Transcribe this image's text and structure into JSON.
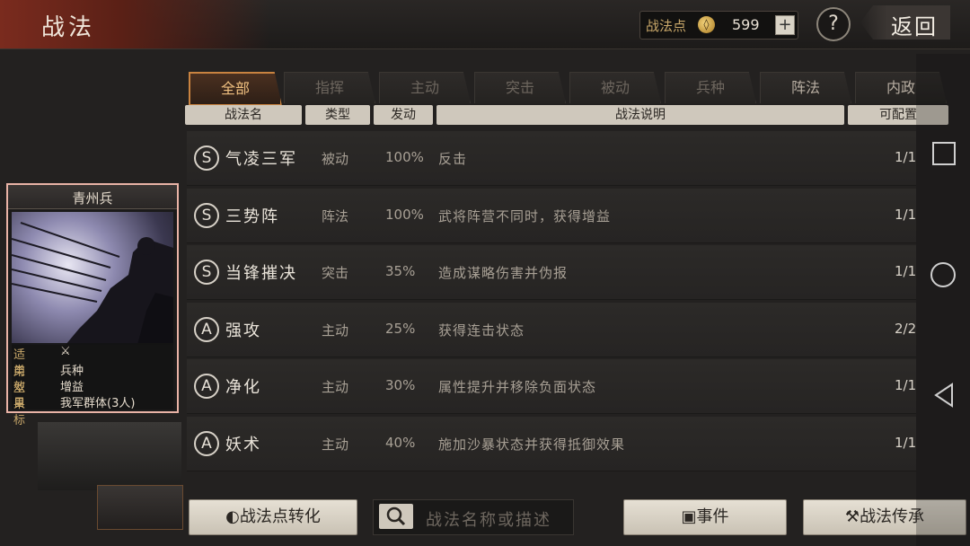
{
  "header": {
    "title": "战法",
    "points_label": "战法点",
    "points_value": "599",
    "help_label": "?",
    "back_label": "返回"
  },
  "tabs": [
    {
      "label": "全部",
      "active": true
    },
    {
      "label": "指挥",
      "active": false
    },
    {
      "label": "主动",
      "active": false
    },
    {
      "label": "突击",
      "active": false
    },
    {
      "label": "被动",
      "active": false
    },
    {
      "label": "兵种",
      "active": false
    },
    {
      "label": "阵法",
      "active": false
    },
    {
      "label": "内政",
      "active": false
    }
  ],
  "columns": {
    "name": "战法名",
    "type": "类型",
    "rate": "发动",
    "desc": "战法说明",
    "count": "可配置"
  },
  "rows": [
    {
      "grade": "S",
      "name": "气凌三军",
      "type": "被动",
      "rate": "100%",
      "desc": "反击",
      "count": "1/1"
    },
    {
      "grade": "S",
      "name": "三势阵",
      "type": "阵法",
      "rate": "100%",
      "desc": "武将阵营不同时，获得增益",
      "count": "1/1"
    },
    {
      "grade": "S",
      "name": "当锋摧决",
      "type": "突击",
      "rate": "35%",
      "desc": "造成谋略伤害并伪报",
      "count": "1/1"
    },
    {
      "grade": "A",
      "name": "强攻",
      "type": "主动",
      "rate": "25%",
      "desc": "获得连击状态",
      "count": "2/2"
    },
    {
      "grade": "A",
      "name": "净化",
      "type": "主动",
      "rate": "30%",
      "desc": "属性提升并移除负面状态",
      "count": "1/1"
    },
    {
      "grade": "A",
      "name": "妖术",
      "type": "主动",
      "rate": "40%",
      "desc": "施加沙暴状态并获得抵御效果",
      "count": "1/1"
    }
  ],
  "card": {
    "title": "青州兵",
    "info": [
      {
        "label": "适用",
        "value": ""
      },
      {
        "label": "类型",
        "value": "兵种"
      },
      {
        "label": "效果",
        "value": "增益"
      },
      {
        "label": "目标",
        "value": "我军群体(3人)"
      }
    ]
  },
  "bottom": {
    "convert_label": "战法点转化",
    "search_placeholder": "战法名称或描述",
    "event_label": "事件",
    "inherit_label": "战法传承"
  }
}
